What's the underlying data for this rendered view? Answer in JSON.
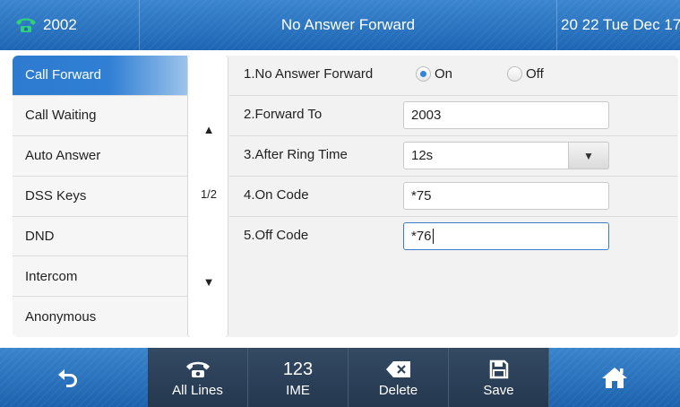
{
  "status_bar": {
    "account_icon": "phone-icon",
    "account_number": "2002",
    "title": "No Answer Forward",
    "datetime": "20 22 Tue Dec 17"
  },
  "menu": {
    "items": [
      {
        "label": "Call Forward",
        "active": true
      },
      {
        "label": "Call Waiting",
        "active": false
      },
      {
        "label": "Auto Answer",
        "active": false
      },
      {
        "label": "DSS Keys",
        "active": false
      },
      {
        "label": "DND",
        "active": false
      },
      {
        "label": "Intercom",
        "active": false
      },
      {
        "label": "Anonymous",
        "active": false
      }
    ]
  },
  "pager": {
    "up_icon": "▲",
    "page": "1/2",
    "down_icon": "▼"
  },
  "form": {
    "no_answer_forward": {
      "label": "1.No Answer Forward",
      "option_on": "On",
      "option_off": "Off",
      "selected": "On"
    },
    "forward_to": {
      "label": "2.Forward To",
      "value": "2003"
    },
    "after_ring_time": {
      "label": "3.After Ring Time",
      "value": "12s",
      "dropdown_icon": "▼"
    },
    "on_code": {
      "label": "4.On Code",
      "value": "*75"
    },
    "off_code": {
      "label": "5.Off Code",
      "value": "*76"
    }
  },
  "softkeys": {
    "back_icon": "back-arrow-icon",
    "all_lines": {
      "label": "All Lines",
      "icon": "phone-icon"
    },
    "ime": {
      "label": "IME",
      "icon_text": "123"
    },
    "delete": {
      "label": "Delete",
      "icon": "backspace-icon"
    },
    "save": {
      "label": "Save",
      "icon": "save-icon"
    },
    "home_icon": "home-icon"
  },
  "colors": {
    "bar_blue": "#2a74c2",
    "active_item": "#2f7fd4",
    "softkey_dark": "#2c425b"
  }
}
